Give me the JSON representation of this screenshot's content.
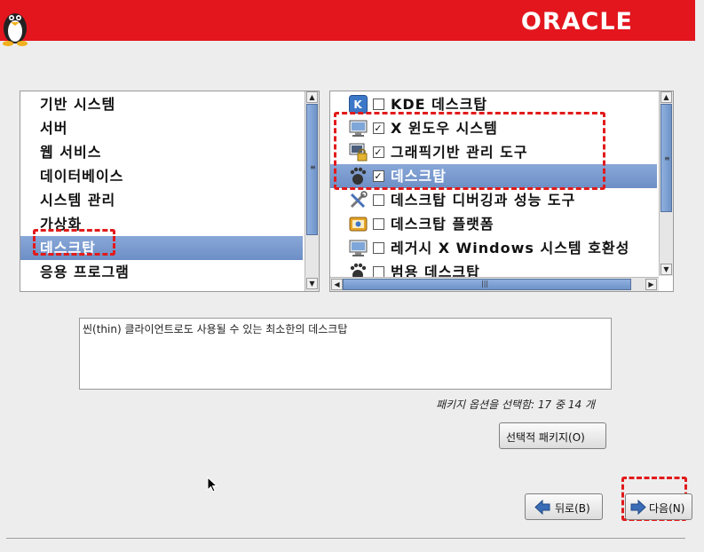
{
  "header": {
    "brand": "ORACLE"
  },
  "categories": [
    {
      "label": "기반 시스템",
      "selected": false
    },
    {
      "label": "서버",
      "selected": false
    },
    {
      "label": "웹 서비스",
      "selected": false
    },
    {
      "label": "데이터베이스",
      "selected": false
    },
    {
      "label": "시스템 관리",
      "selected": false
    },
    {
      "label": "가상화",
      "selected": false
    },
    {
      "label": "데스크탑",
      "selected": true
    },
    {
      "label": "응용 프로그램",
      "selected": false
    }
  ],
  "options": [
    {
      "label": "KDE 데스크탑",
      "checked": false,
      "icon": "kde-icon",
      "selected": false
    },
    {
      "label": "X 윈도우 시스템",
      "checked": true,
      "icon": "monitor-icon",
      "selected": false
    },
    {
      "label": "그래픽기반 관리 도구",
      "checked": true,
      "icon": "admin-lock-icon",
      "selected": false
    },
    {
      "label": "데스크탑",
      "checked": true,
      "icon": "gnome-foot-icon",
      "selected": true
    },
    {
      "label": "데스크탑 디버깅과 성능 도구",
      "checked": false,
      "icon": "tools-icon",
      "selected": false
    },
    {
      "label": "데스크탑 플랫폼",
      "checked": false,
      "icon": "platform-icon",
      "selected": false
    },
    {
      "label": "레거시 X Windows 시스템 호환성",
      "checked": false,
      "icon": "monitor-icon",
      "selected": false
    },
    {
      "label": "범용 데스크탑",
      "checked": false,
      "icon": "gnome-foot-icon",
      "selected": false
    }
  ],
  "description": "씬(thin) 클라이언트로도 사용될 수 있는 최소한의 데스크탑",
  "package_count": "패키지 옵션을 선택함: 17 중 14 개",
  "buttons": {
    "optional_packages": "선택적 패키지(O)",
    "back": "뒤로(B)",
    "next": "다음(N)"
  },
  "colors": {
    "banner": "#e3161e",
    "selection": "#7596cc",
    "highlight_dash": "#e21a1a"
  }
}
